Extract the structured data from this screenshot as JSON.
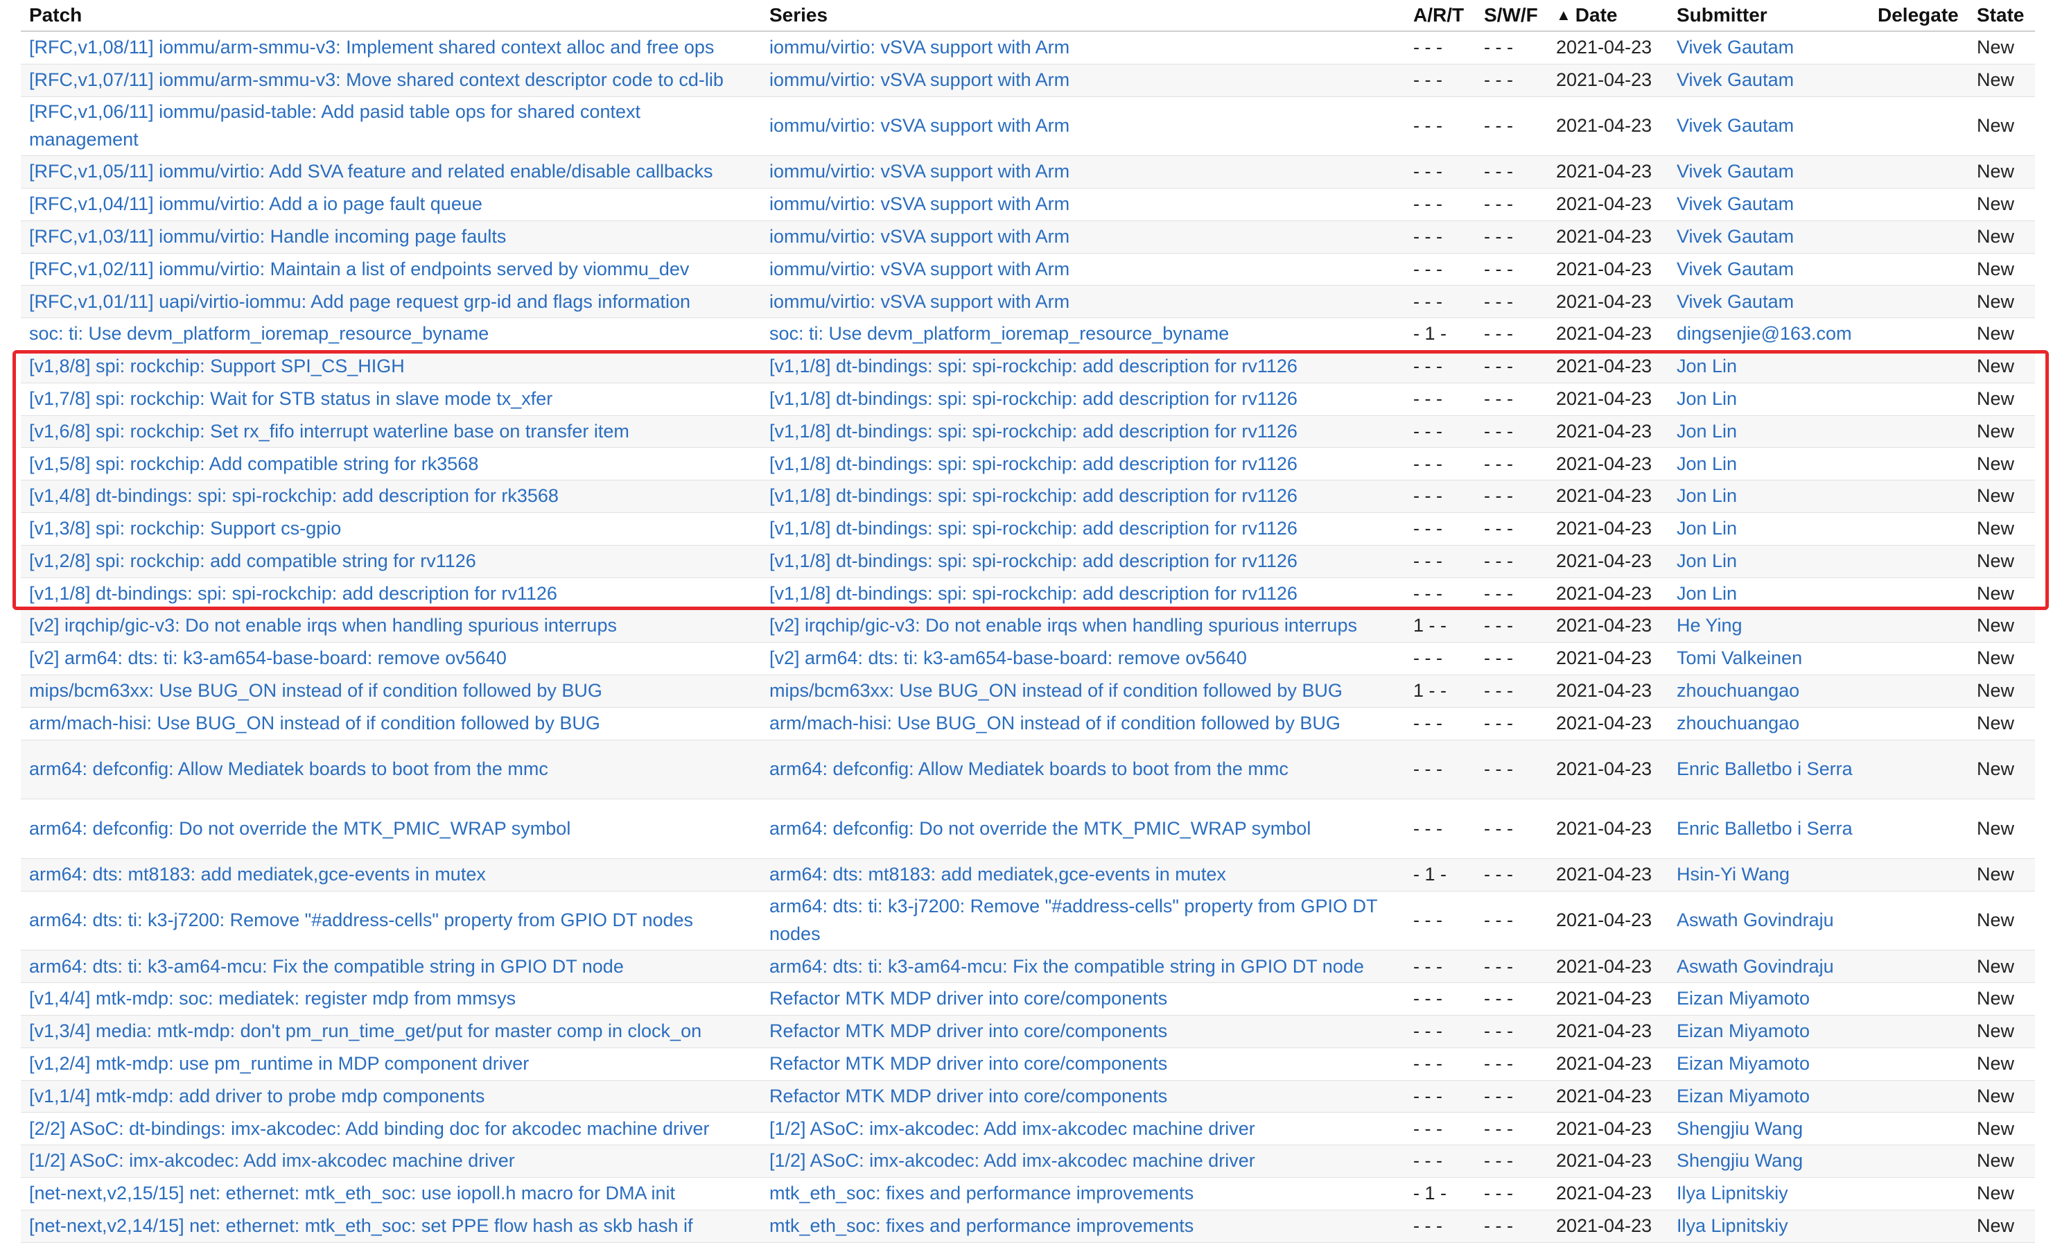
{
  "columns": {
    "patch": "Patch",
    "series": "Series",
    "art": "A/R/T",
    "swf": "S/W/F",
    "date": "Date",
    "submitter": "Submitter",
    "delegate": "Delegate",
    "state": "State"
  },
  "sort_icon": "caret-up-icon",
  "accent": {
    "link_color": "#2a6dbf",
    "highlight_color": "#e8262b"
  },
  "rows": [
    {
      "patch": "[RFC,v1,08/11] iommu/arm-smmu-v3: Implement shared context alloc and free ops",
      "series": "iommu/virtio: vSVA support with Arm",
      "art": "- - -",
      "swf": "-   -   -",
      "date": "2021-04-23",
      "submitter": "Vivek Gautam",
      "delegate": "",
      "state": "New"
    },
    {
      "patch": "[RFC,v1,07/11] iommu/arm-smmu-v3: Move shared context descriptor code to cd-lib",
      "series": "iommu/virtio: vSVA support with Arm",
      "art": "- - -",
      "swf": "-   -   -",
      "date": "2021-04-23",
      "submitter": "Vivek Gautam",
      "delegate": "",
      "state": "New"
    },
    {
      "patch": "[RFC,v1,06/11] iommu/pasid-table: Add pasid table ops for shared context management",
      "series": "iommu/virtio: vSVA support with Arm",
      "art": "- - -",
      "swf": "-   -   -",
      "date": "2021-04-23",
      "submitter": "Vivek Gautam",
      "delegate": "",
      "state": "New",
      "tall": true
    },
    {
      "patch": "[RFC,v1,05/11] iommu/virtio: Add SVA feature and related enable/disable callbacks",
      "series": "iommu/virtio: vSVA support with Arm",
      "art": "- - -",
      "swf": "-   -   -",
      "date": "2021-04-23",
      "submitter": "Vivek Gautam",
      "delegate": "",
      "state": "New"
    },
    {
      "patch": "[RFC,v1,04/11] iommu/virtio: Add a io page fault queue",
      "series": "iommu/virtio: vSVA support with Arm",
      "art": "- - -",
      "swf": "-   -   -",
      "date": "2021-04-23",
      "submitter": "Vivek Gautam",
      "delegate": "",
      "state": "New"
    },
    {
      "patch": "[RFC,v1,03/11] iommu/virtio: Handle incoming page faults",
      "series": "iommu/virtio: vSVA support with Arm",
      "art": "- - -",
      "swf": "-   -   -",
      "date": "2021-04-23",
      "submitter": "Vivek Gautam",
      "delegate": "",
      "state": "New"
    },
    {
      "patch": "[RFC,v1,02/11] iommu/virtio: Maintain a list of endpoints served by viommu_dev",
      "series": "iommu/virtio: vSVA support with Arm",
      "art": "- - -",
      "swf": "-   -   -",
      "date": "2021-04-23",
      "submitter": "Vivek Gautam",
      "delegate": "",
      "state": "New"
    },
    {
      "patch": "[RFC,v1,01/11] uapi/virtio-iommu: Add page request grp-id and flags information",
      "series": "iommu/virtio: vSVA support with Arm",
      "art": "- - -",
      "swf": "-   -   -",
      "date": "2021-04-23",
      "submitter": "Vivek Gautam",
      "delegate": "",
      "state": "New"
    },
    {
      "patch": "soc: ti: Use devm_platform_ioremap_resource_byname",
      "series": "soc: ti: Use devm_platform_ioremap_resource_byname",
      "art": "- 1 -",
      "swf": "-   -   -",
      "date": "2021-04-23",
      "submitter": "dingsenjie@163.com",
      "delegate": "",
      "state": "New"
    },
    {
      "patch": "[v1,8/8] spi: rockchip: Support SPI_CS_HIGH",
      "series": "[v1,1/8] dt-bindings: spi: spi-rockchip: add description for rv1126",
      "art": "- - -",
      "swf": "-   -   -",
      "date": "2021-04-23",
      "submitter": "Jon Lin",
      "delegate": "",
      "state": "New"
    },
    {
      "patch": "[v1,7/8] spi: rockchip: Wait for STB status in slave mode tx_xfer",
      "series": "[v1,1/8] dt-bindings: spi: spi-rockchip: add description for rv1126",
      "art": "- - -",
      "swf": "-   -   -",
      "date": "2021-04-23",
      "submitter": "Jon Lin",
      "delegate": "",
      "state": "New"
    },
    {
      "patch": "[v1,6/8] spi: rockchip: Set rx_fifo interrupt waterline base on transfer item",
      "series": "[v1,1/8] dt-bindings: spi: spi-rockchip: add description for rv1126",
      "art": "- - -",
      "swf": "-   -   -",
      "date": "2021-04-23",
      "submitter": "Jon Lin",
      "delegate": "",
      "state": "New"
    },
    {
      "patch": "[v1,5/8] spi: rockchip: Add compatible string for rk3568",
      "series": "[v1,1/8] dt-bindings: spi: spi-rockchip: add description for rv1126",
      "art": "- - -",
      "swf": "-   -   -",
      "date": "2021-04-23",
      "submitter": "Jon Lin",
      "delegate": "",
      "state": "New"
    },
    {
      "patch": "[v1,4/8] dt-bindings: spi: spi-rockchip: add description for rk3568",
      "series": "[v1,1/8] dt-bindings: spi: spi-rockchip: add description for rv1126",
      "art": "- - -",
      "swf": "-   -   -",
      "date": "2021-04-23",
      "submitter": "Jon Lin",
      "delegate": "",
      "state": "New"
    },
    {
      "patch": "[v1,3/8] spi: rockchip: Support cs-gpio",
      "series": "[v1,1/8] dt-bindings: spi: spi-rockchip: add description for rv1126",
      "art": "- - -",
      "swf": "-   -   -",
      "date": "2021-04-23",
      "submitter": "Jon Lin",
      "delegate": "",
      "state": "New"
    },
    {
      "patch": "[v1,2/8] spi: rockchip: add compatible string for rv1126",
      "series": "[v1,1/8] dt-bindings: spi: spi-rockchip: add description for rv1126",
      "art": "- - -",
      "swf": "-   -   -",
      "date": "2021-04-23",
      "submitter": "Jon Lin",
      "delegate": "",
      "state": "New"
    },
    {
      "patch": "[v1,1/8] dt-bindings: spi: spi-rockchip: add description for rv1126",
      "series": "[v1,1/8] dt-bindings: spi: spi-rockchip: add description for rv1126",
      "art": "- - -",
      "swf": "-   -   -",
      "date": "2021-04-23",
      "submitter": "Jon Lin",
      "delegate": "",
      "state": "New"
    },
    {
      "patch": "[v2] irqchip/gic-v3: Do not enable irqs when handling spurious interrups",
      "series": "[v2] irqchip/gic-v3: Do not enable irqs when handling spurious interrups",
      "art": "1 - -",
      "swf": "-   -   -",
      "date": "2021-04-23",
      "submitter": "He Ying",
      "delegate": "",
      "state": "New"
    },
    {
      "patch": "[v2] arm64: dts: ti: k3-am654-base-board: remove ov5640",
      "series": "[v2] arm64: dts: ti: k3-am654-base-board: remove ov5640",
      "art": "- - -",
      "swf": "-   -   -",
      "date": "2021-04-23",
      "submitter": "Tomi Valkeinen",
      "delegate": "",
      "state": "New"
    },
    {
      "patch": "mips/bcm63xx: Use BUG_ON instead of if condition followed by BUG",
      "series": "mips/bcm63xx: Use BUG_ON instead of if condition followed by BUG",
      "art": "1 - -",
      "swf": "-   -   -",
      "date": "2021-04-23",
      "submitter": "zhouchuangao",
      "delegate": "",
      "state": "New"
    },
    {
      "patch": "arm/mach-hisi: Use BUG_ON instead of if condition followed by BUG",
      "series": "arm/mach-hisi: Use BUG_ON instead of if condition followed by BUG",
      "art": "- - -",
      "swf": "-   -   -",
      "date": "2021-04-23",
      "submitter": "zhouchuangao",
      "delegate": "",
      "state": "New"
    },
    {
      "patch": "arm64: defconfig: Allow Mediatek boards to boot from the mmc",
      "series": "arm64: defconfig: Allow Mediatek boards to boot from the mmc",
      "art": "- - -",
      "swf": "-   -   -",
      "date": "2021-04-23",
      "submitter": "Enric Balletbo i Serra",
      "delegate": "",
      "state": "New",
      "tall": true
    },
    {
      "patch": "arm64: defconfig: Do not override the MTK_PMIC_WRAP symbol",
      "series": "arm64: defconfig: Do not override the MTK_PMIC_WRAP symbol",
      "art": "- - -",
      "swf": "-   -   -",
      "date": "2021-04-23",
      "submitter": "Enric Balletbo i Serra",
      "delegate": "",
      "state": "New",
      "tall": true
    },
    {
      "patch": "arm64: dts: mt8183: add mediatek,gce-events in mutex",
      "series": "arm64: dts: mt8183: add mediatek,gce-events in mutex",
      "art": "- 1 -",
      "swf": "-   -   -",
      "date": "2021-04-23",
      "submitter": "Hsin-Yi Wang",
      "delegate": "",
      "state": "New"
    },
    {
      "patch": "arm64: dts: ti: k3-j7200: Remove \"#address-cells\" property from GPIO DT nodes",
      "series": "arm64: dts: ti: k3-j7200: Remove \"#address-cells\" property from GPIO DT nodes",
      "art": "- - -",
      "swf": "-   -   -",
      "date": "2021-04-23",
      "submitter": "Aswath Govindraju",
      "delegate": "",
      "state": "New",
      "tall": true
    },
    {
      "patch": "arm64: dts: ti: k3-am64-mcu: Fix the compatible string in GPIO DT node",
      "series": "arm64: dts: ti: k3-am64-mcu: Fix the compatible string in GPIO DT node",
      "art": "- - -",
      "swf": "-   -   -",
      "date": "2021-04-23",
      "submitter": "Aswath Govindraju",
      "delegate": "",
      "state": "New"
    },
    {
      "patch": "[v1,4/4] mtk-mdp: soc: mediatek: register mdp from mmsys",
      "series": "Refactor MTK MDP driver into core/components",
      "art": "- - -",
      "swf": "-   -   -",
      "date": "2021-04-23",
      "submitter": "Eizan Miyamoto",
      "delegate": "",
      "state": "New"
    },
    {
      "patch": "[v1,3/4] media: mtk-mdp: don't pm_run_time_get/put for master comp in clock_on",
      "series": "Refactor MTK MDP driver into core/components",
      "art": "- - -",
      "swf": "-   -   -",
      "date": "2021-04-23",
      "submitter": "Eizan Miyamoto",
      "delegate": "",
      "state": "New"
    },
    {
      "patch": "[v1,2/4] mtk-mdp: use pm_runtime in MDP component driver",
      "series": "Refactor MTK MDP driver into core/components",
      "art": "- - -",
      "swf": "-   -   -",
      "date": "2021-04-23",
      "submitter": "Eizan Miyamoto",
      "delegate": "",
      "state": "New"
    },
    {
      "patch": "[v1,1/4] mtk-mdp: add driver to probe mdp components",
      "series": "Refactor MTK MDP driver into core/components",
      "art": "- - -",
      "swf": "-   -   -",
      "date": "2021-04-23",
      "submitter": "Eizan Miyamoto",
      "delegate": "",
      "state": "New"
    },
    {
      "patch": "[2/2] ASoC: dt-bindings: imx-akcodec: Add binding doc for akcodec machine driver",
      "series": "[1/2] ASoC: imx-akcodec: Add imx-akcodec machine driver",
      "art": "- - -",
      "swf": "-   -   -",
      "date": "2021-04-23",
      "submitter": "Shengjiu Wang",
      "delegate": "",
      "state": "New"
    },
    {
      "patch": "[1/2] ASoC: imx-akcodec: Add imx-akcodec machine driver",
      "series": "[1/2] ASoC: imx-akcodec: Add imx-akcodec machine driver",
      "art": "- - -",
      "swf": "-   -   -",
      "date": "2021-04-23",
      "submitter": "Shengjiu Wang",
      "delegate": "",
      "state": "New"
    },
    {
      "patch": "[net-next,v2,15/15] net: ethernet: mtk_eth_soc: use iopoll.h macro for DMA init",
      "series": "mtk_eth_soc: fixes and performance improvements",
      "art": "- 1 -",
      "swf": "-   -   -",
      "date": "2021-04-23",
      "submitter": "Ilya Lipnitskiy",
      "delegate": "",
      "state": "New"
    },
    {
      "patch": "[net-next,v2,14/15] net: ethernet: mtk_eth_soc: set PPE flow hash as skb hash if",
      "series": "mtk_eth_soc: fixes and performance improvements",
      "art": "- - -",
      "swf": "-   -   -",
      "date": "2021-04-23",
      "submitter": "Ilya Lipnitskiy",
      "delegate": "",
      "state": "New"
    }
  ]
}
